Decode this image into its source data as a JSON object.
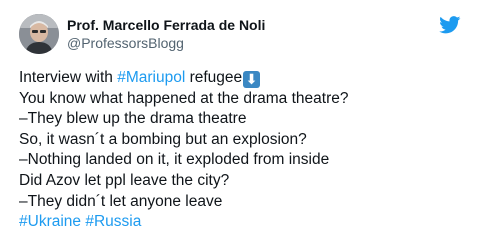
{
  "author": {
    "display_name": "Prof. Marcello Ferrada de Noli",
    "handle": "@ProfessorsBlogg",
    "avatar": "profile-photo"
  },
  "brand_icon": "twitter-bird-icon",
  "colors": {
    "hashtag": "#1d9bf0",
    "text": "#0f1419",
    "secondary": "#536471",
    "emoji": "#3b88c3"
  },
  "tweet": {
    "line1": {
      "prefix": "Interview with ",
      "hashtag": "#Mariupol",
      "suffix": " refugee",
      "emoji": "⬇"
    },
    "line2": "You know what happened at the drama theatre?",
    "line3": "–They blew up the drama theatre",
    "line4": "So, it wasn´t a bombing but an explosion?",
    "line5": "–Nothing landed on it, it exploded from inside",
    "line6": "Did Azov let ppl leave the city?",
    "line7": "–They didn´t let anyone leave",
    "hashtags": [
      "#Ukraine",
      "#Russia"
    ]
  }
}
